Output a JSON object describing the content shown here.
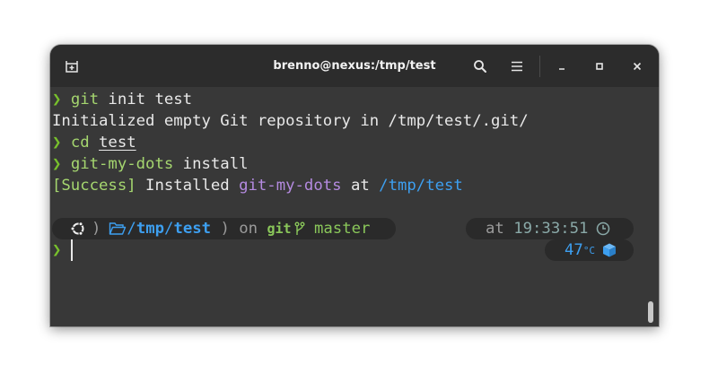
{
  "window": {
    "title": "brenno@nexus:/tmp/test"
  },
  "icons": {
    "new_tab": "new-tab-icon",
    "search": "search-icon",
    "menu": "hamburger-menu-icon",
    "minimize": "minimize-icon",
    "maximize": "maximize-icon",
    "close": "close-icon",
    "os": "ubuntu-icon",
    "folder": "folder-open-icon",
    "branch": "git-branch-icon",
    "clock": "clock-icon",
    "temperature": "cube-icon"
  },
  "colors": {
    "prompt_arrow": "#78c02c",
    "command": "#a5d66f",
    "path": "#3d9ff0",
    "package": "#b48ae0"
  },
  "terminal": {
    "prompt_symbol": "❯",
    "lines": [
      {
        "cmd": "git",
        "args": " init test"
      },
      {
        "output": "Initialized empty Git repository in /tmp/test/.git/"
      },
      {
        "cmd": "cd",
        "sep": " ",
        "arg": "test"
      },
      {
        "cmd": "git-my-dots",
        "args": " install"
      },
      {
        "tag": "[Success]",
        "t1": " Installed ",
        "pkg": "git-my-dots",
        "t2": " at ",
        "path": "/tmp/test"
      }
    ],
    "prompt": {
      "path_root": "/",
      "path_dir1": "tmp",
      "path_sep": "/",
      "path_dir2": "test",
      "on": "on",
      "git_label": "git",
      "branch": "master",
      "at": "at",
      "time": "19:33:51",
      "temperature": "47",
      "temperature_unit": "°C"
    }
  }
}
